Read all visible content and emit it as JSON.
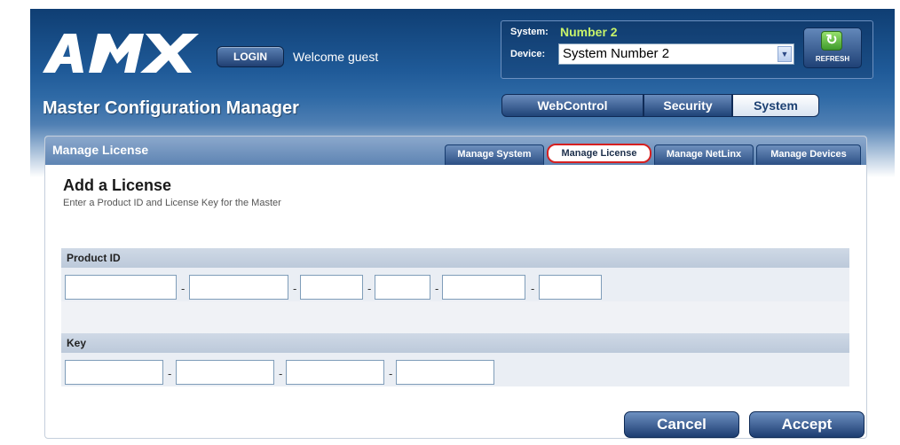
{
  "header": {
    "logo_text": "AMX",
    "login_label": "LOGIN",
    "welcome_text": "Welcome guest"
  },
  "system_selector": {
    "system_label": "System:",
    "system_value": "Number 2",
    "device_label": "Device:",
    "device_selected": "System Number 2",
    "refresh_label": "REFRESH",
    "refresh_icon": "refresh-icon"
  },
  "app": {
    "title": "Master Configuration Manager"
  },
  "main_tabs": [
    {
      "label": "WebControl",
      "active": false
    },
    {
      "label": "Security",
      "active": false
    },
    {
      "label": "System",
      "active": true
    }
  ],
  "panel": {
    "title": "Manage License",
    "sub_tabs": [
      {
        "label": "Manage System",
        "active": false
      },
      {
        "label": "Manage License",
        "active": true
      },
      {
        "label": "Manage NetLinx",
        "active": false
      },
      {
        "label": "Manage Devices",
        "active": false
      }
    ]
  },
  "form": {
    "title": "Add a License",
    "subtitle": "Enter a Product ID and License Key for the Master",
    "product_id_label": "Product ID",
    "key_label": "Key",
    "separator": "-",
    "product_id_fields": [
      "",
      "",
      "",
      "",
      "",
      ""
    ],
    "key_fields": [
      "",
      "",
      "",
      ""
    ]
  },
  "actions": {
    "cancel_label": "Cancel",
    "accept_label": "Accept"
  },
  "colors": {
    "header_dark": "#0f3e73",
    "system_value": "#c7f26a",
    "active_subtab_outline": "#d62020"
  }
}
